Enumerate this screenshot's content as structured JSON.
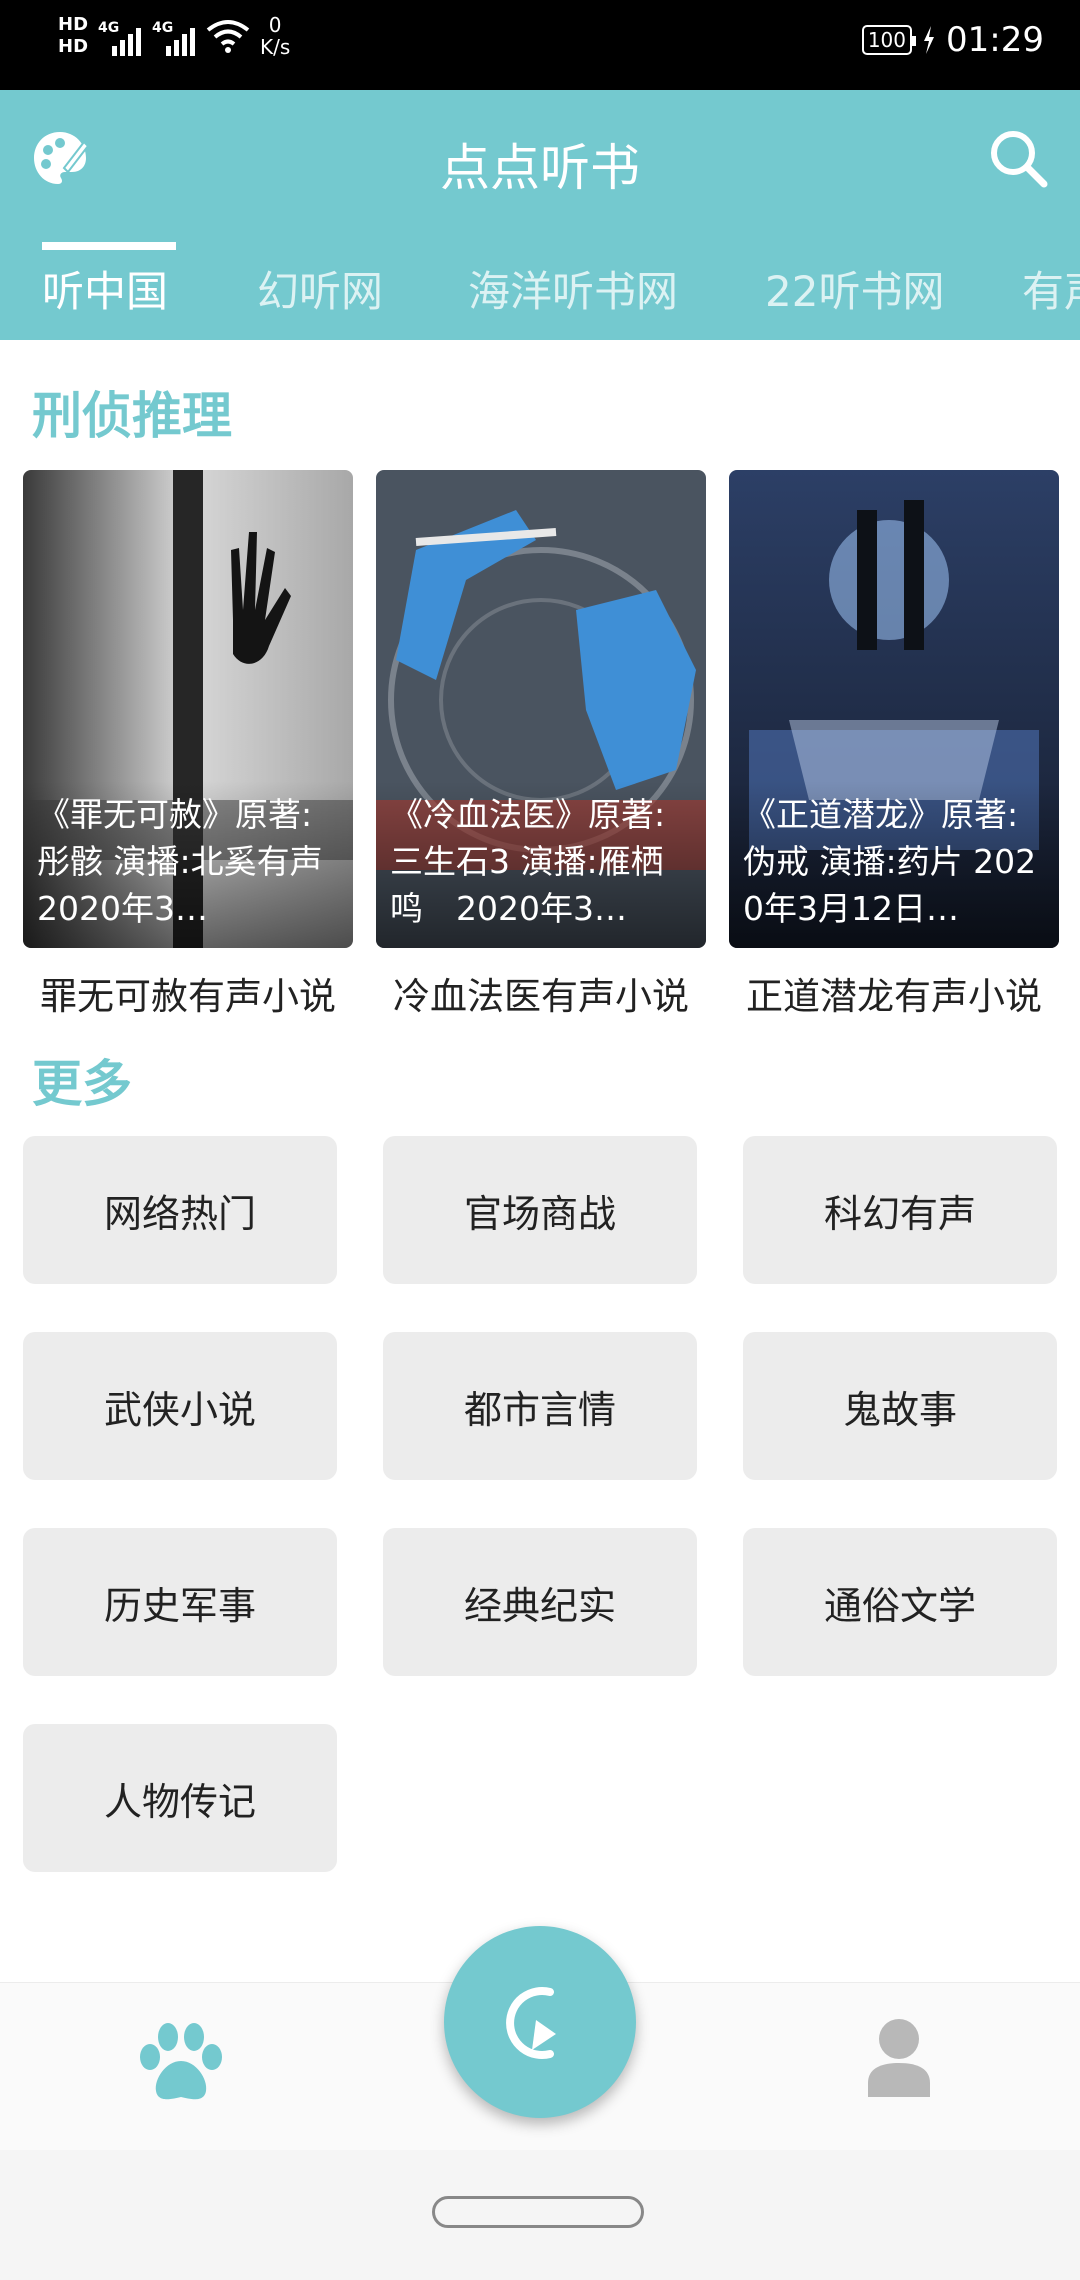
{
  "status_bar": {
    "hd1": "HD",
    "hd2": "HD",
    "net1": "4G",
    "net2": "4G",
    "speed_value": "0",
    "speed_unit": "K/s",
    "battery": "100",
    "time": "01:29"
  },
  "header": {
    "title": "点点听书",
    "tabs": [
      "听中国",
      "幻听网",
      "海洋听书网",
      "22听书网",
      "有声"
    ],
    "accent_color": "#74c9cf"
  },
  "featured": {
    "section_title": "刑侦推理",
    "books": [
      {
        "caption": "《罪无可赦》原著:彤骸 演播:北奚有声　2020年3…",
        "title": "罪无可赦有声小说"
      },
      {
        "caption": "《冷血法医》原著:三生石3 演播:雁栖鸣　2020年3…",
        "title": "冷血法医有声小说"
      },
      {
        "caption": "《正道潜龙》原著:伪戒 演播:药片 2020年3月12日…",
        "title": "正道潜龙有声小说"
      }
    ]
  },
  "more": {
    "section_title": "更多",
    "categories": [
      "网络热门",
      "官场商战",
      "科幻有声",
      "武侠小说",
      "都市言情",
      "鬼故事",
      "历史军事",
      "经典纪实",
      "通俗文学",
      "人物传记"
    ]
  },
  "icons": {
    "palette": "palette-icon",
    "search": "search-icon",
    "paw": "paw-icon",
    "play_history": "play-history-icon",
    "profile": "person-icon"
  }
}
